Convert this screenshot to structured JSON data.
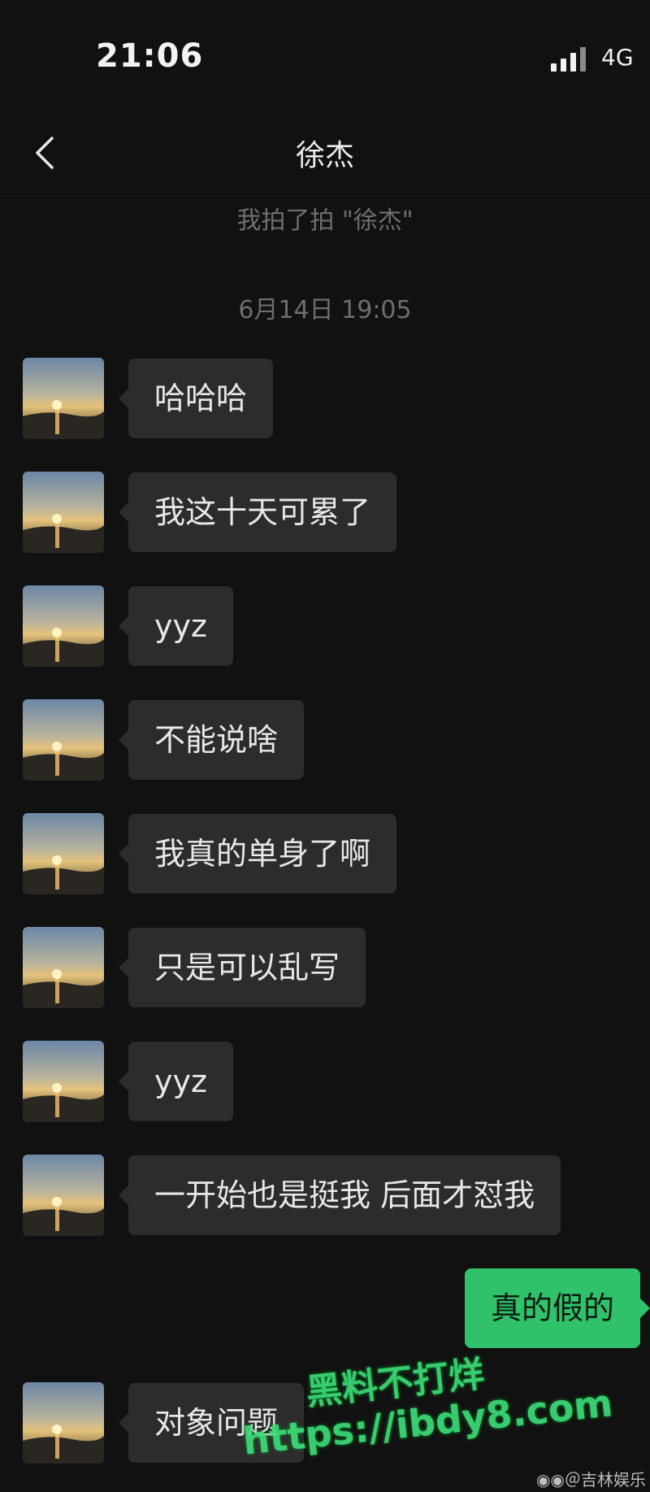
{
  "status_bar": {
    "time": "21:06",
    "network": "4G"
  },
  "nav": {
    "title": "徐杰"
  },
  "system": {
    "pat_notice": "我拍了拍 \"徐杰\"",
    "timestamp": "6月14日 19:05"
  },
  "messages": [
    {
      "side": "in",
      "text": "哈哈哈"
    },
    {
      "side": "in",
      "text": "我这十天可累了"
    },
    {
      "side": "in",
      "text": "yyz"
    },
    {
      "side": "in",
      "text": "不能说啥"
    },
    {
      "side": "in",
      "text": "我真的单身了啊"
    },
    {
      "side": "in",
      "text": "只是可以乱写"
    },
    {
      "side": "in",
      "text": "yyz"
    },
    {
      "side": "in",
      "text": "一开始也是挺我 后面才怼我"
    },
    {
      "side": "out",
      "text": "真的假的"
    },
    {
      "side": "in",
      "text": "对象问题"
    }
  ],
  "watermark": {
    "line1": "黑料不打烊",
    "line2": "https://ibdy8.com"
  },
  "weibo_mark": "＠吉林娱乐"
}
